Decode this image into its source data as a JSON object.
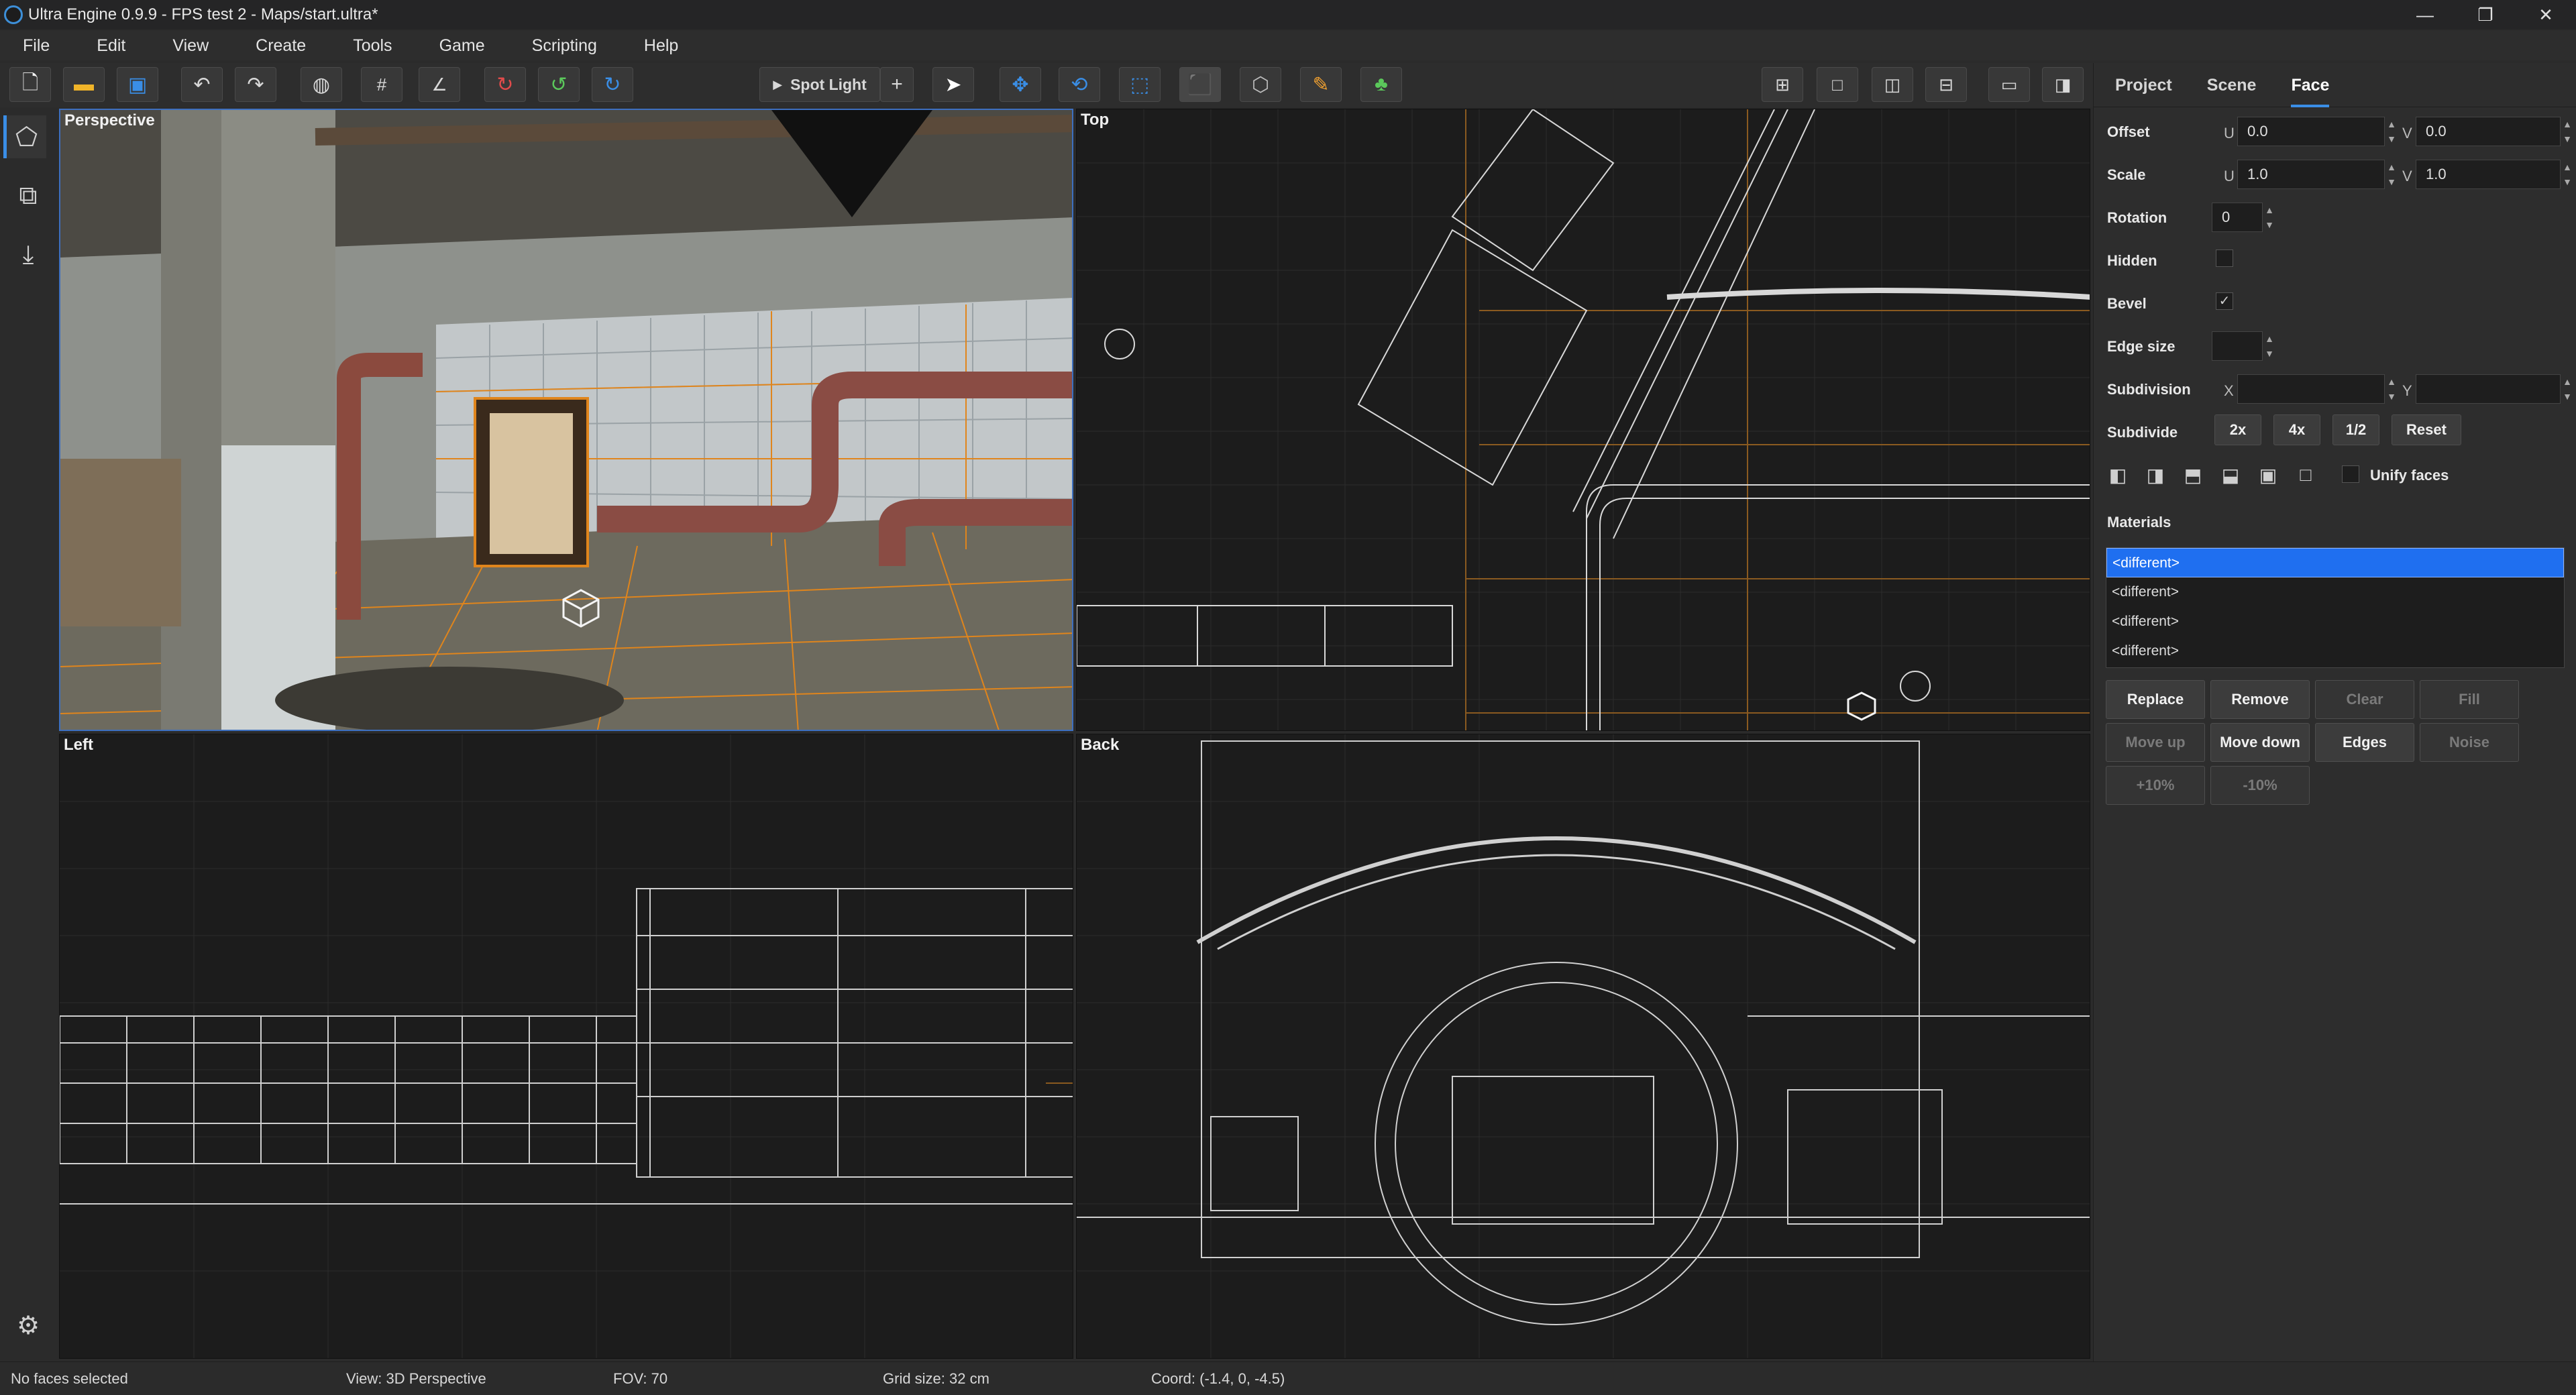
{
  "window": {
    "title": "Ultra Engine 0.9.9 - FPS test 2 - Maps/start.ultra*",
    "controls": [
      "—",
      "❐",
      "✕"
    ]
  },
  "menu": [
    "File",
    "Edit",
    "View",
    "Create",
    "Tools",
    "Game",
    "Scripting",
    "Help"
  ],
  "toolbar": {
    "spot_light_label": "Spot Light"
  },
  "viewports": {
    "perspective": "Perspective",
    "top": "Top",
    "left": "Left",
    "back": "Back"
  },
  "panel": {
    "tabs": [
      "Project",
      "Scene",
      "Face"
    ],
    "active_tab": "Face",
    "offset": {
      "label": "Offset",
      "u_label": "U",
      "u": "0.0",
      "v_label": "V",
      "v": "0.0"
    },
    "scale": {
      "label": "Scale",
      "u_label": "U",
      "u": "1.0",
      "v_label": "V",
      "v": "1.0"
    },
    "rotation": {
      "label": "Rotation",
      "value": "0"
    },
    "hidden": {
      "label": "Hidden",
      "checked": false
    },
    "bevel": {
      "label": "Bevel",
      "checked": true
    },
    "edge_size": {
      "label": "Edge size",
      "value": ""
    },
    "subdivision": {
      "label": "Subdivision",
      "x_label": "X",
      "y_label": "Y"
    },
    "subdivide": {
      "label": "Subdivide",
      "buttons": [
        "2x",
        "4x",
        "1/2",
        "Reset"
      ]
    },
    "unify_faces": "Unify faces",
    "materials_label": "Materials",
    "materials": [
      "<different>",
      "<different>",
      "<different>",
      "<different>"
    ],
    "buttons": {
      "replace": "Replace",
      "remove": "Remove",
      "clear": "Clear",
      "fill": "Fill",
      "move_up": "Move up",
      "move_down": "Move down",
      "edges": "Edges",
      "noise": "Noise",
      "plus10": "+10%",
      "minus10": "-10%"
    }
  },
  "status": {
    "selection": "No faces selected",
    "view": "View: 3D Perspective",
    "fov": "FOV: 70",
    "grid": "Grid size: 32 cm",
    "coord": "Coord: (-1.4, 0, -4.5)"
  }
}
